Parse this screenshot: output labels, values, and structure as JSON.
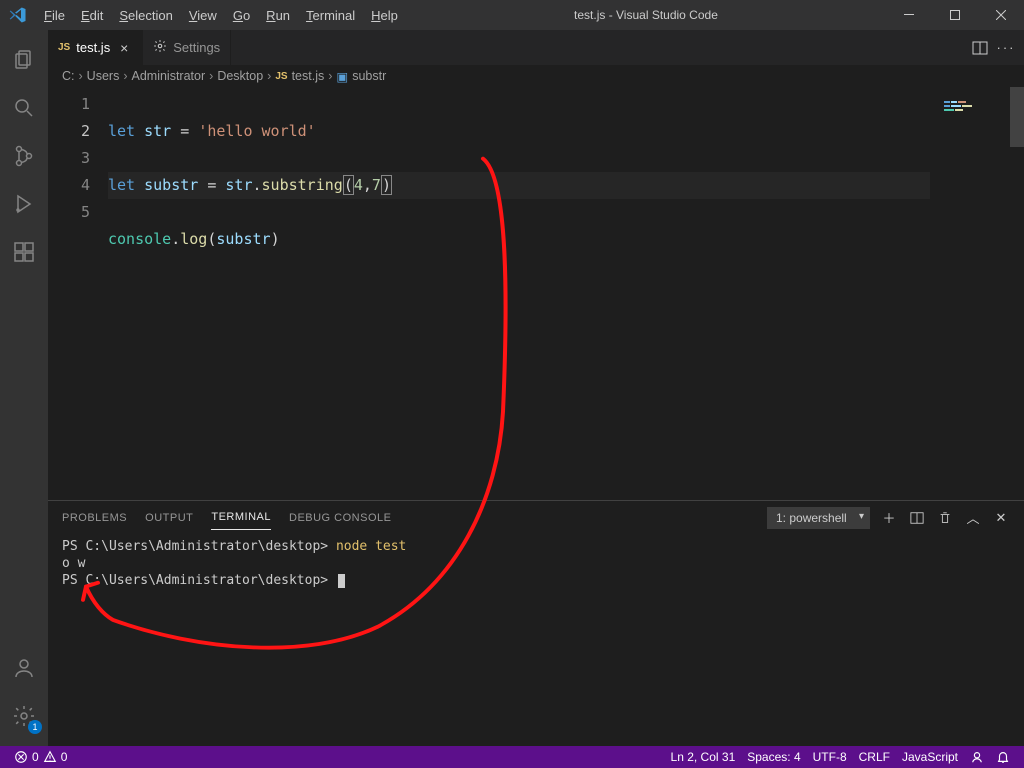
{
  "window": {
    "title": "test.js - Visual Studio Code"
  },
  "menu": {
    "file": "File",
    "edit": "Edit",
    "selection": "Selection",
    "view": "View",
    "go": "Go",
    "run": "Run",
    "terminal": "Terminal",
    "help": "Help"
  },
  "tabs": {
    "active": "test.js",
    "inactive": "Settings"
  },
  "editor_actions": {
    "split": "split-editor",
    "more": "more-actions"
  },
  "breadcrumb": {
    "parts": [
      "C:",
      "Users",
      "Administrator",
      "Desktop"
    ],
    "file": "test.js",
    "symbol": "substr"
  },
  "activity": {
    "settings_badge": "1"
  },
  "code": {
    "line1": {
      "kw": "let",
      "var": "str",
      "eq": " = ",
      "str": "'hello world'"
    },
    "line2": {
      "kw": "let",
      "var": "substr",
      "eq": " = ",
      "obj": "str",
      "dot": ".",
      "fn": "substring",
      "lp": "(",
      "a": "4",
      "comma": ",",
      "b": "7",
      "rp": ")"
    },
    "line3": {
      "obj": "console",
      "dot": ".",
      "fn": "log",
      "lp": "(",
      "var": "substr",
      "rp": ")"
    },
    "lineno": {
      "l1": "1",
      "l2": "2",
      "l3": "3",
      "l4": "4",
      "l5": "5"
    }
  },
  "panel": {
    "tabs": {
      "problems": "Problems",
      "output": "Output",
      "terminal": "Terminal",
      "debug": "Debug Console"
    },
    "shell_label": "1: powershell",
    "terminal": {
      "line1_prefix": "PS C:\\Users\\Administrator\\desktop> ",
      "line1_cmd": "node test",
      "line2": "o w",
      "line3": "PS C:\\Users\\Administrator\\desktop> "
    }
  },
  "status": {
    "errors": "0",
    "warnings": "0",
    "ln_col": "Ln 2, Col 31",
    "spaces": "Spaces: 4",
    "encoding": "UTF-8",
    "eol": "CRLF",
    "lang": "JavaScript"
  },
  "colors": {
    "accent": "#5c0f8b"
  }
}
